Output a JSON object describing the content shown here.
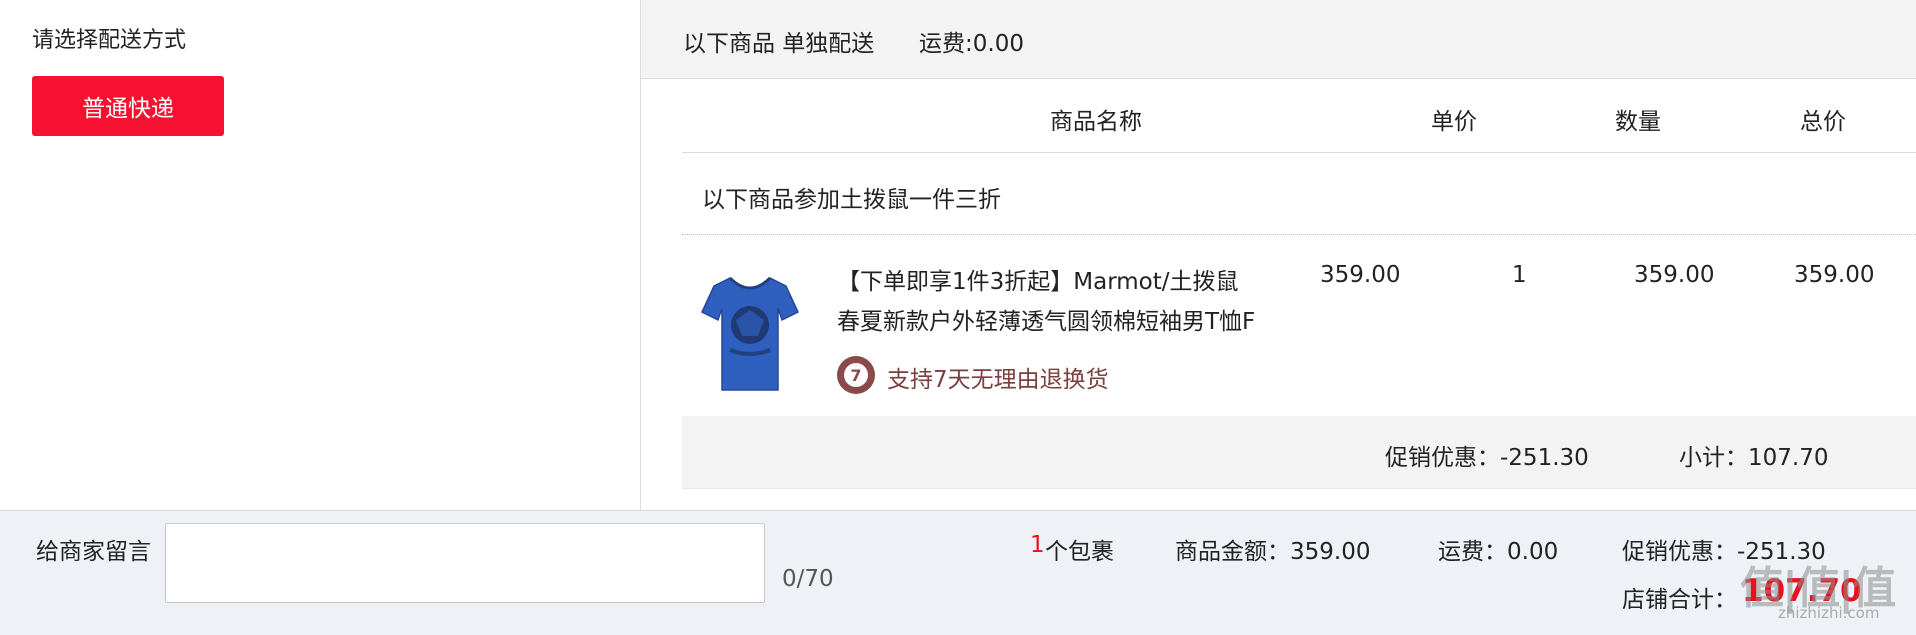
{
  "delivery": {
    "title": "请选择配送方式",
    "method_button": "普通快递"
  },
  "shipment": {
    "header_label": "以下商品 单独配送",
    "header_fee": "运费:0.00"
  },
  "table": {
    "columns": [
      "商品名称",
      "单价",
      "数量",
      "总价"
    ]
  },
  "promotion": {
    "label": "以下商品参加土拨鼠一件三折"
  },
  "product": {
    "name_line_1": "【下单即享1件3折起】Marmot/土拨鼠",
    "name_line_2": "春夏新款户外轻薄透气圆领棉短袖男T恤F",
    "return_icon_glyph": "7",
    "return_policy": "支持7天无理由退换货",
    "price": "359.00",
    "quantity": "1",
    "subtotal": "359.00",
    "total": "359.00",
    "image_icon": "blue-tshirt-icon",
    "image_color": "#2f5fbf"
  },
  "summary": {
    "discount": "促销优惠：-251.30",
    "subtotal": "小计：107.70"
  },
  "footer": {
    "message_label": "给商家留言",
    "message_value": "",
    "message_count": "0/70",
    "package_count": "1",
    "package_label": "个包裹",
    "goods_amount": "商品金额：359.00",
    "shipping": "运费：0.00",
    "discount": "促销优惠：-251.30",
    "store_total_label": "店铺合计：",
    "store_total_value": "107.70"
  },
  "watermark": {
    "main": "值|值|值",
    "sub": "zhizhizhi.com"
  },
  "colors": {
    "accent_red": "#f5112f",
    "price_red": "#e8121e",
    "panel_gray": "#f3f3f3",
    "return_brown": "#8a4a4a"
  }
}
